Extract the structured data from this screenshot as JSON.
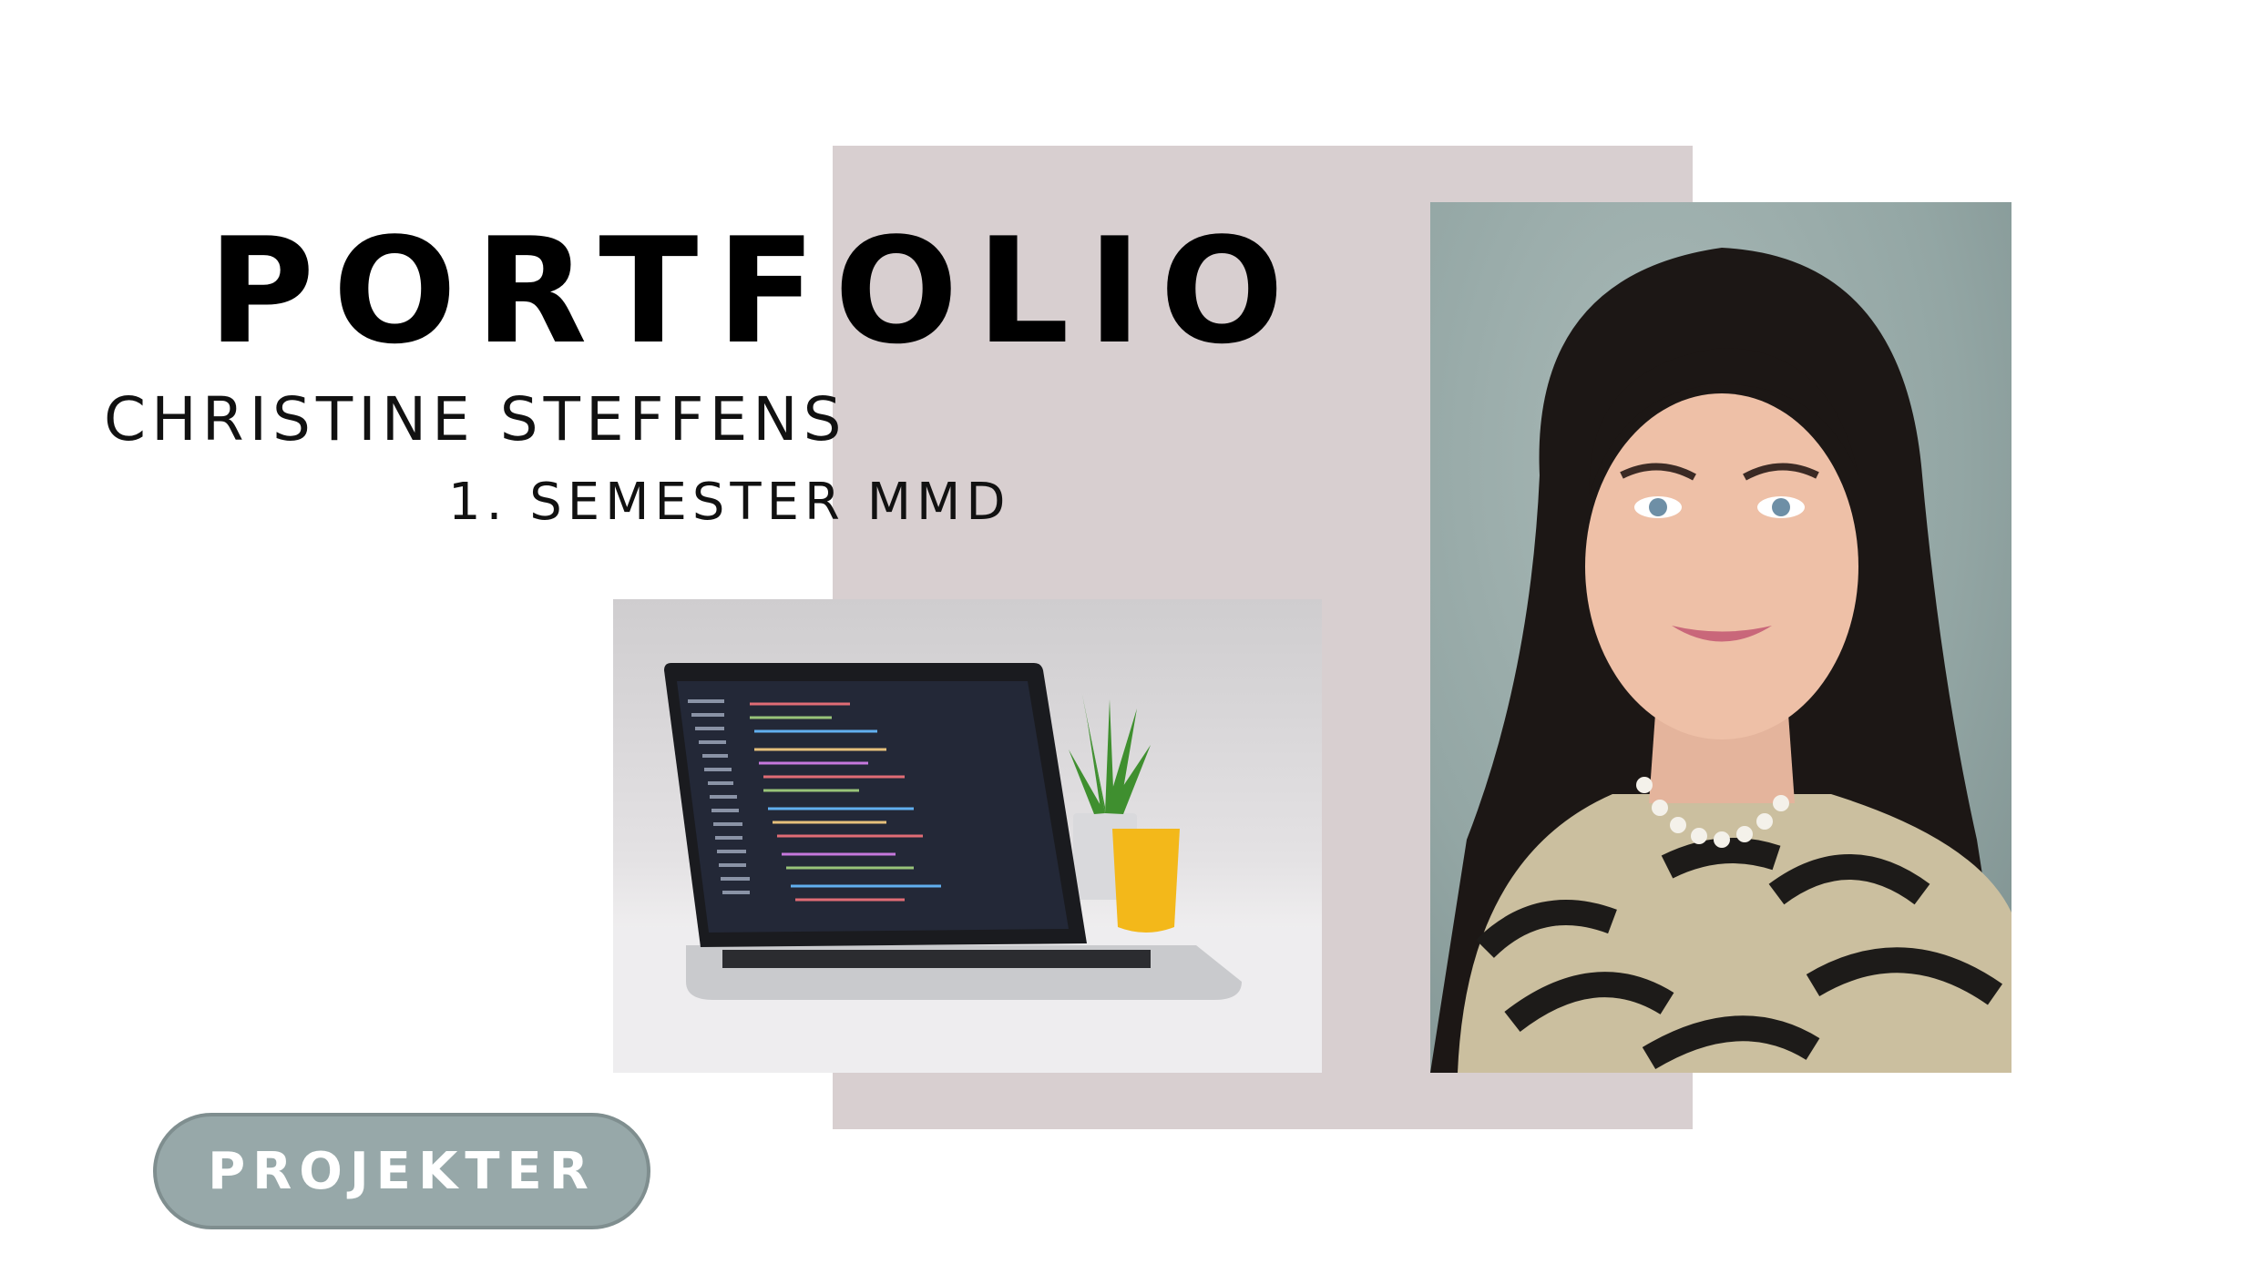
{
  "hero": {
    "title": "PORTFOLIO",
    "name": "CHRISTINE STEFFENS",
    "subtitle": "1. SEMESTER MMD"
  },
  "navigation": {
    "projects_label": "PROJEKTER"
  },
  "colors": {
    "backdrop": "#d8cfd0",
    "button": "#97a8a9",
    "text": "#000000"
  },
  "images": {
    "laptop": "laptop-photo",
    "portrait": "portrait-photo"
  }
}
